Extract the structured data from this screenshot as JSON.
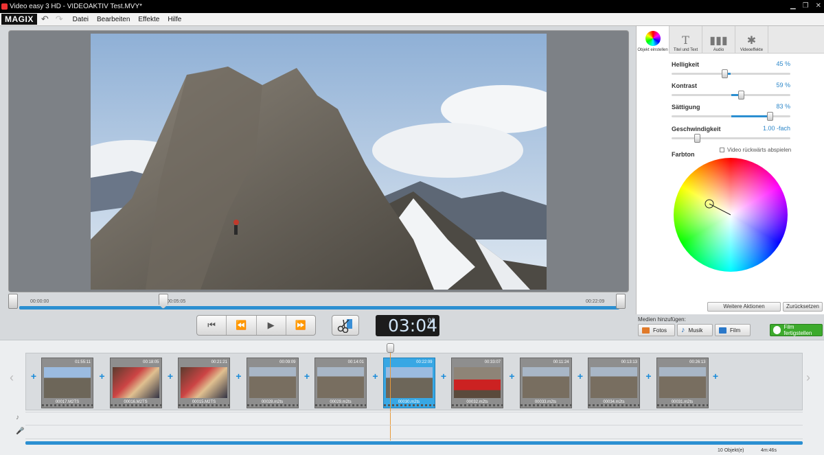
{
  "window": {
    "title": "Video easy 3 HD - VIDEOAKTIV Test.MVY*"
  },
  "menubar": {
    "logo": "MAGIX",
    "items": [
      "Datei",
      "Bearbeiten",
      "Effekte",
      "Hilfe"
    ]
  },
  "preview": {
    "time_start": "00:00:00",
    "time_marker": "00:05:05",
    "time_end": "00:22:09",
    "position_fraction": 0.24
  },
  "transport": {
    "timecode": "03:04",
    "frames": "02"
  },
  "right_panel": {
    "tabs": [
      {
        "label": "Objekt einstellen",
        "icon": "color-wheel-icon"
      },
      {
        "label": "Titel und Text",
        "icon": "text-t-icon"
      },
      {
        "label": "Audio",
        "icon": "audio-wave-icon"
      },
      {
        "label": "Videoeffekte",
        "icon": "sparkle-icon"
      }
    ],
    "props": [
      {
        "label": "Helligkeit",
        "value": "45 %",
        "level": 0.45
      },
      {
        "label": "Kontrast",
        "value": "59 %",
        "level": 0.59
      },
      {
        "label": "Sättigung",
        "value": "83 %",
        "level": 0.83
      },
      {
        "label": "Geschwindigkeit",
        "value": "1.00 -fach",
        "level": 0.22
      }
    ],
    "reverse_checkbox": "Video rückwärts abspielen",
    "farbton_label": "Farbton",
    "weitere_label": "Weitere Aktionen",
    "reset_label": "Zurücksetzen"
  },
  "media": {
    "label": "Medien hinzufügen:",
    "buttons": [
      "Fotos",
      "Musik",
      "Film"
    ],
    "finish_label": "Film fertigstellen"
  },
  "clips": [
    {
      "name": "00017.M2TS",
      "duration": "01:55:11",
      "selected": false,
      "scene": "mountain"
    },
    {
      "name": "00016.M2TS",
      "duration": "00:18:05",
      "selected": false,
      "scene": "people"
    },
    {
      "name": "00015.M2TS",
      "duration": "00:21:21",
      "selected": false,
      "scene": "people"
    },
    {
      "name": "00028.m2ts",
      "duration": "00:09:09",
      "selected": false,
      "scene": "rock"
    },
    {
      "name": "00029.m2ts",
      "duration": "00:14:01",
      "selected": false,
      "scene": "rock"
    },
    {
      "name": "00030.m2ts",
      "duration": "00:22:09",
      "selected": true,
      "scene": "mountain"
    },
    {
      "name": "00032.m2ts",
      "duration": "00:33:07",
      "selected": false,
      "scene": "red"
    },
    {
      "name": "00033.m2ts",
      "duration": "00:11:24",
      "selected": false,
      "scene": "rock"
    },
    {
      "name": "00034.m2ts",
      "duration": "00:13:13",
      "selected": false,
      "scene": "rock"
    },
    {
      "name": "00031.m2ts",
      "duration": "00:26:13",
      "selected": false,
      "scene": "rock"
    }
  ],
  "status": {
    "objects": "10 Objekt(e)",
    "length": "4m:46s"
  }
}
